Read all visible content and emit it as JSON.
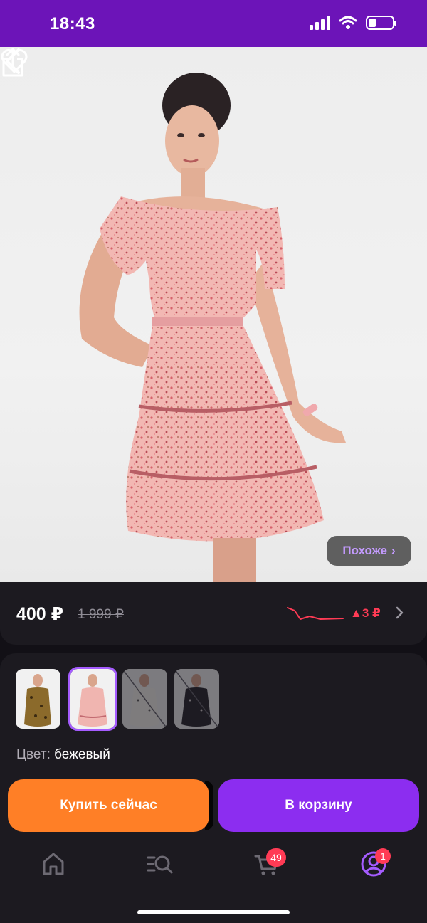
{
  "status_bar": {
    "time": "18:43",
    "icons": [
      "signal-icon",
      "wifi-icon",
      "battery-icon"
    ],
    "battery_level": 0.3
  },
  "product_image": {
    "alt": "Pink floral off-shoulder dress on model",
    "buttons": {
      "back_icon": "chevron-left-icon",
      "favorite_icon": "heart-icon",
      "share_icon": "share-icon"
    },
    "similar_label": "Похоже",
    "similar_chevron": "›"
  },
  "price": {
    "current": "400 ₽",
    "old": "1 999 ₽",
    "change": "▲3 ₽",
    "trend_color": "#ff3b55",
    "chevron": "chevron-right-icon"
  },
  "variants": {
    "thumbnails": [
      {
        "name": "variant-leopard",
        "selected": false,
        "available": true
      },
      {
        "name": "variant-pink",
        "selected": true,
        "available": true
      },
      {
        "name": "variant-white",
        "selected": false,
        "available": false
      },
      {
        "name": "variant-black",
        "selected": false,
        "available": false
      }
    ],
    "color_label": "Цвет:",
    "color_value": "бежевый"
  },
  "actions": {
    "buy_now": "Купить сейчас",
    "add_to_cart": "В корзину",
    "buy_color": "#ff7f26",
    "cart_color": "#8c2df0"
  },
  "tab_bar": {
    "tabs": [
      {
        "name": "home",
        "icon": "home-icon",
        "active": false
      },
      {
        "name": "catalog",
        "icon": "catalog-search-icon",
        "active": false
      },
      {
        "name": "cart",
        "icon": "cart-icon",
        "active": false,
        "badge": "49"
      },
      {
        "name": "profile",
        "icon": "profile-icon",
        "active": true,
        "badge": "1"
      }
    ]
  },
  "accent": "#6c14b8"
}
